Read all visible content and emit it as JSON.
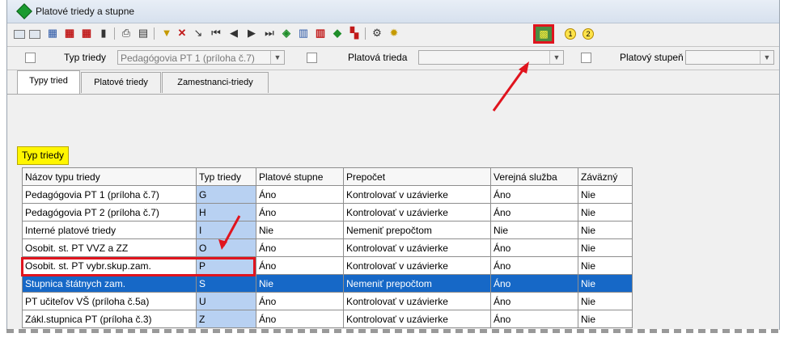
{
  "window": {
    "title": "Platové triedy a stupne"
  },
  "toolbar": {
    "icons": [
      "grid-icon",
      "grid-alt-icon",
      "table-icon",
      "table-edit-icon",
      "table-add-icon",
      "delete-icon",
      "print-icon",
      "calendar-icon",
      "filter-icon",
      "clear-filter-icon",
      "tag-icon",
      "first-icon",
      "prev-icon",
      "next-icon",
      "last-icon",
      "refresh-icon",
      "report-icon",
      "lock-icon",
      "sort-icon",
      "tree-icon",
      "settings-icon",
      "bulb-icon",
      "highlighted-action-icon",
      "circle-one-icon",
      "circle-two-icon"
    ],
    "circle_labels": [
      "1",
      "2"
    ]
  },
  "filter": {
    "type_label": "Typ triedy",
    "type_value": "Pedagógovia PT 1 (príloha č.7)",
    "class_label": "Platová trieda",
    "class_value": "",
    "step_label": "Platový stupeň",
    "step_value": ""
  },
  "tabs": [
    "Typy tried",
    "Platové triedy",
    "Zamestnanci-triedy"
  ],
  "section_label": "Typ triedy",
  "table": {
    "columns": [
      "Názov typu triedy",
      "Typ triedy",
      "Platové stupne",
      "Prepočet",
      "Verejná služba",
      "Záväzný"
    ],
    "rows": [
      {
        "name": "Pedagógovia PT 1 (príloha č.7)",
        "code": "G",
        "steps": "Áno",
        "calc": "Kontrolovať v uzávierke",
        "public": "Áno",
        "binding": "Nie"
      },
      {
        "name": "Pedagógovia PT 2 (príloha č.7)",
        "code": "H",
        "steps": "Áno",
        "calc": "Kontrolovať v uzávierke",
        "public": "Áno",
        "binding": "Nie"
      },
      {
        "name": "Interné platové triedy",
        "code": "I",
        "steps": "Nie",
        "calc": "Nemeniť prepočtom",
        "public": "Nie",
        "binding": "Nie"
      },
      {
        "name": "Osobit. st. PT VVZ a ZZ",
        "code": "O",
        "steps": "Áno",
        "calc": "Kontrolovať v uzávierke",
        "public": "Áno",
        "binding": "Nie"
      },
      {
        "name": "Osobit. st. PT vybr.skup.zam.",
        "code": "P",
        "steps": "Áno",
        "calc": "Kontrolovať v uzávierke",
        "public": "Áno",
        "binding": "Nie"
      },
      {
        "name": "Stupnica štátnych zam.",
        "code": "S",
        "steps": "Nie",
        "calc": "Nemeniť prepočtom",
        "public": "Áno",
        "binding": "Nie"
      },
      {
        "name": "PT učiteľov VŠ (príloha č.5a)",
        "code": "U",
        "steps": "Áno",
        "calc": "Kontrolovať v uzávierke",
        "public": "Áno",
        "binding": "Nie"
      },
      {
        "name": "Zákl.stupnica PT (príloha č.3)",
        "code": "Z",
        "steps": "Áno",
        "calc": "Kontrolovať v uzávierke",
        "public": "Áno",
        "binding": "Nie"
      }
    ],
    "selected_row": 5
  },
  "colors": {
    "accent": "#e0141e",
    "selection": "#1668c7",
    "highlight": "#fff600",
    "code_cell": "#b8d1f2"
  }
}
